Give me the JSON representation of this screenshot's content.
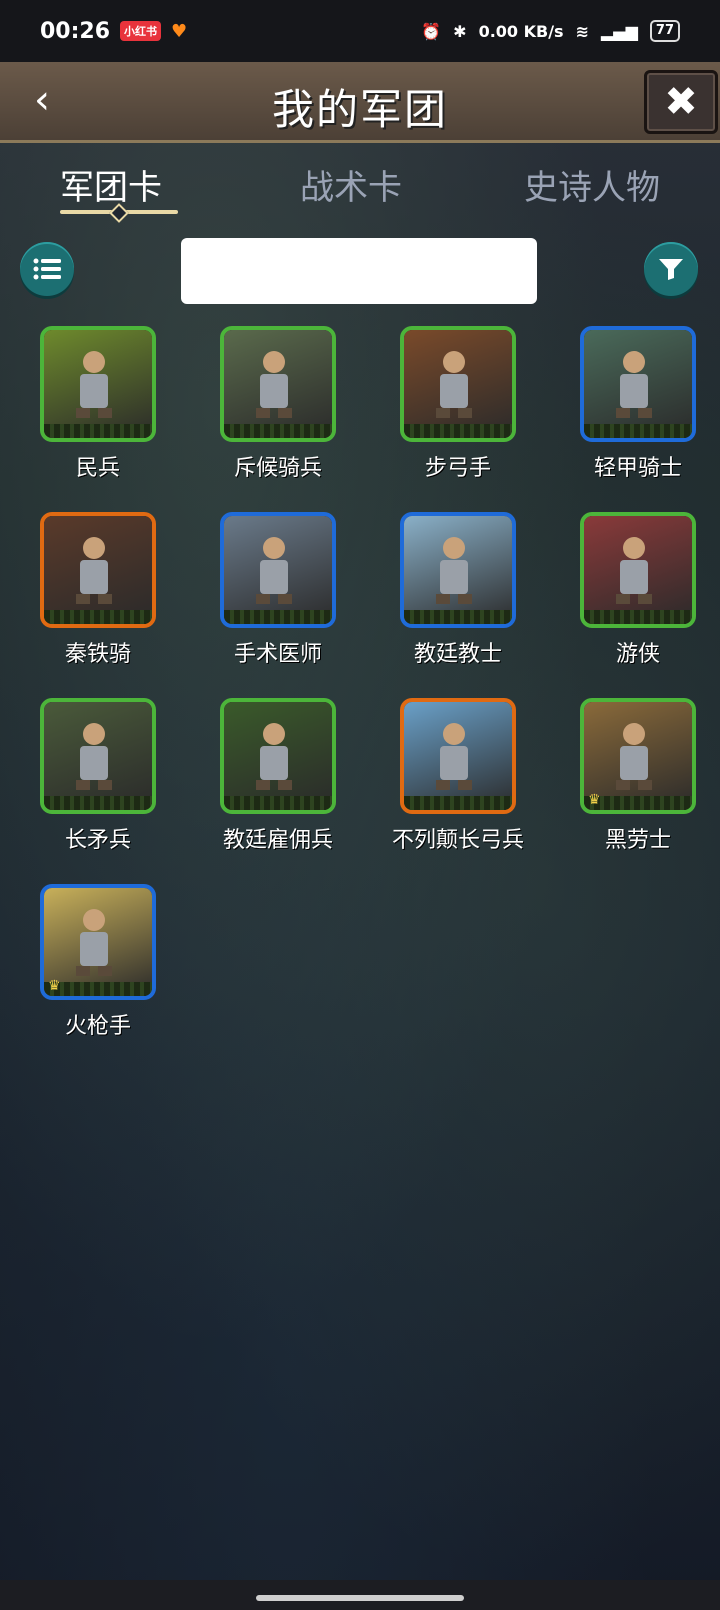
{
  "status_bar": {
    "time": "00:26",
    "net_speed": "0.00 KB/s",
    "battery": "77"
  },
  "header": {
    "title": "我的军团",
    "back_icon": "chevron-left-icon",
    "close_icon": "close-icon"
  },
  "tabs": [
    {
      "label": "军团卡",
      "active": true
    },
    {
      "label": "战术卡",
      "active": false
    },
    {
      "label": "史诗人物",
      "active": false
    }
  ],
  "search": {
    "value": "",
    "placeholder": ""
  },
  "cards": [
    {
      "name": "民兵",
      "rarity": "green",
      "art": "#6e8a2c"
    },
    {
      "name": "斥候骑兵",
      "rarity": "green",
      "art": "#5a6a4c"
    },
    {
      "name": "步弓手",
      "rarity": "green",
      "art": "#7a4a2a"
    },
    {
      "name": "轻甲骑士",
      "rarity": "blue",
      "art": "#4a6a5a"
    },
    {
      "name": "秦铁骑",
      "rarity": "orange",
      "art": "#5a3a2a"
    },
    {
      "name": "手术医师",
      "rarity": "blue",
      "art": "#6a7a8a"
    },
    {
      "name": "教廷教士",
      "rarity": "blue",
      "art": "#8ab0c8"
    },
    {
      "name": "游侠",
      "rarity": "green",
      "art": "#8a3a3a"
    },
    {
      "name": "长矛兵",
      "rarity": "green",
      "art": "#4a5a3a"
    },
    {
      "name": "教廷雇佣兵",
      "rarity": "green",
      "art": "#3a5a2a"
    },
    {
      "name": "不列颠长弓兵",
      "rarity": "orange",
      "art": "#6aa0c8"
    },
    {
      "name": "黑劳士",
      "rarity": "green",
      "art": "#8a6a3a",
      "crown": true
    },
    {
      "name": "火枪手",
      "rarity": "blue",
      "art": "#c8b05a",
      "crown": true
    }
  ],
  "colors": {
    "green": "#4cb53a",
    "blue": "#1f6bd9",
    "orange": "#e06a12",
    "accent": "#1c6f72"
  }
}
